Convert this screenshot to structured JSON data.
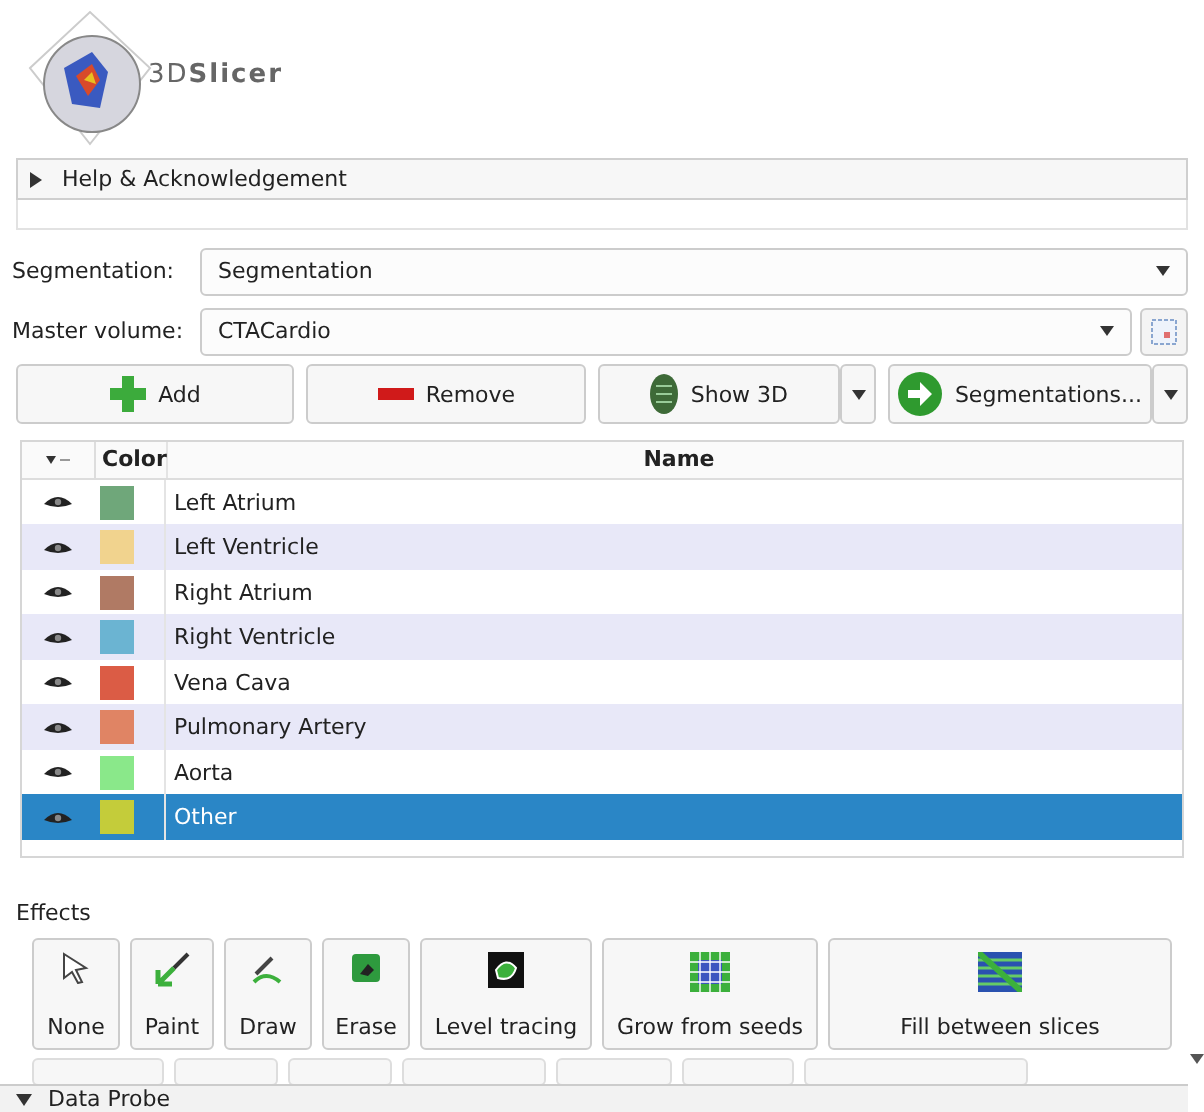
{
  "logo": {
    "text": "3D**Slicer**"
  },
  "help_section": {
    "label": "Help & Acknowledgement",
    "expanded": false
  },
  "segmentation": {
    "label": "Segmentation:",
    "value": "Segmentation"
  },
  "master_volume": {
    "label": "Master volume:",
    "value": "CTACardio"
  },
  "buttons": [
    {
      "kind": "add",
      "label": "Add",
      "has_menu": false
    },
    {
      "kind": "remove",
      "label": "Remove",
      "has_menu": false
    },
    {
      "kind": "show3d",
      "label": "Show 3D",
      "has_menu": true
    },
    {
      "kind": "segmentations",
      "label": "Segmentations...",
      "has_menu": true
    }
  ],
  "table": {
    "columns": [
      "Color",
      "Name"
    ],
    "rows": [
      {
        "name": "Left Atrium",
        "color": "#6fa77a",
        "visible": true,
        "selected": false
      },
      {
        "name": "Left Ventricle",
        "color": "#f1d38e",
        "visible": true,
        "selected": false
      },
      {
        "name": "Right Atrium",
        "color": "#b07a64",
        "visible": true,
        "selected": false
      },
      {
        "name": "Right Ventricle",
        "color": "#6bb4d2",
        "visible": true,
        "selected": false
      },
      {
        "name": "Vena Cava",
        "color": "#db5c45",
        "visible": true,
        "selected": false
      },
      {
        "name": "Pulmonary Artery",
        "color": "#e08464",
        "visible": true,
        "selected": false
      },
      {
        "name": "Aorta",
        "color": "#8ae88a",
        "visible": true,
        "selected": false
      },
      {
        "name": "Other",
        "color": "#c4cc3a",
        "visible": true,
        "selected": true
      }
    ]
  },
  "effects": {
    "title": "Effects",
    "items": [
      {
        "kind": "none",
        "label": "None"
      },
      {
        "kind": "paint",
        "label": "Paint"
      },
      {
        "kind": "draw",
        "label": "Draw"
      },
      {
        "kind": "erase",
        "label": "Erase"
      },
      {
        "kind": "level",
        "label": "Level tracing"
      },
      {
        "kind": "grow",
        "label": "Grow from seeds"
      },
      {
        "kind": "fill",
        "label": "Fill between slices"
      }
    ]
  },
  "data_probe": {
    "label": "Data Probe",
    "expanded": true
  }
}
